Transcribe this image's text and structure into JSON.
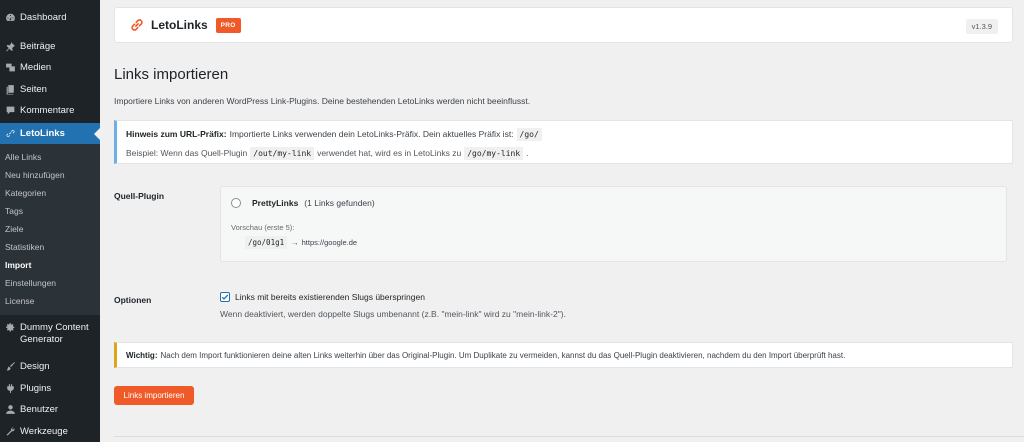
{
  "sidebar": {
    "top_items": [
      {
        "label": "Dashboard",
        "icon": "dashboard-icon"
      },
      {
        "label": "Beiträge",
        "icon": "pin-icon"
      },
      {
        "label": "Medien",
        "icon": "media-icon"
      },
      {
        "label": "Seiten",
        "icon": "pages-icon"
      },
      {
        "label": "Kommentare",
        "icon": "comment-icon"
      }
    ],
    "current": {
      "label": "LetoLinks",
      "icon": "link-icon"
    },
    "submenu": [
      "Alle Links",
      "Neu hinzufügen",
      "Kategorien",
      "Tags",
      "Ziele",
      "Statistiken",
      "Import",
      "Einstellungen",
      "License"
    ],
    "submenu_active": "Import",
    "dummy": {
      "label": "Dummy Content Generator",
      "icon": "gear-icon"
    },
    "bottom_items": [
      {
        "label": "Design",
        "icon": "brush-icon"
      },
      {
        "label": "Plugins",
        "icon": "plugin-icon"
      },
      {
        "label": "Benutzer",
        "icon": "user-icon"
      },
      {
        "label": "Werkzeuge",
        "icon": "wrench-icon"
      }
    ]
  },
  "header": {
    "logo_text": "LetoLinks",
    "badge": "PRO",
    "version": "v1.3.9"
  },
  "page": {
    "title": "Links importieren",
    "description": "Importiere Links von anderen WordPress Link-Plugins. Deine bestehenden LetoLinks werden nicht beeinflusst."
  },
  "info_notice": {
    "heading": "Hinweis zum URL-Präfix:",
    "text": "Importierte Links verwenden dein LetoLinks-Präfix. Dein aktuelles Präfix ist:",
    "prefix": "/go/",
    "example_a": "Beispiel: Wenn das Quell-Plugin",
    "example_code1": "/out/my-link",
    "example_b": "verwendet hat, wird es in LetoLinks zu",
    "example_code2": "/go/my-link",
    "example_c": "."
  },
  "source": {
    "label": "Quell-Plugin",
    "plugin_name": "PrettyLinks",
    "plugin_count": "(1 Links gefunden)",
    "preview_label": "Vorschau (erste 5):",
    "preview_slug": "/go/01g1",
    "preview_arrow": "→",
    "preview_url": "https://google.de"
  },
  "options": {
    "label": "Optionen",
    "checkbox_label": "Links mit bereits existierenden Slugs überspringen",
    "checked": true,
    "help": "Wenn deaktiviert, werden doppelte Slugs umbenannt (z.B. \"mein-link\" wird zu \"mein-link-2\")."
  },
  "warning": {
    "heading": "Wichtig:",
    "text": "Nach dem Import funktionieren deine alten Links weiterhin über das Original-Plugin. Um Duplikate zu vermeiden, kannst du das Quell-Plugin deaktivieren, nachdem du den Import überprüft hast."
  },
  "import_button": "Links importieren",
  "colors": {
    "accent": "#f05a28",
    "wp_blue": "#2271b1",
    "sidebar": "#1d2327",
    "info_border": "#72aee6",
    "warn_border": "#dba617"
  }
}
